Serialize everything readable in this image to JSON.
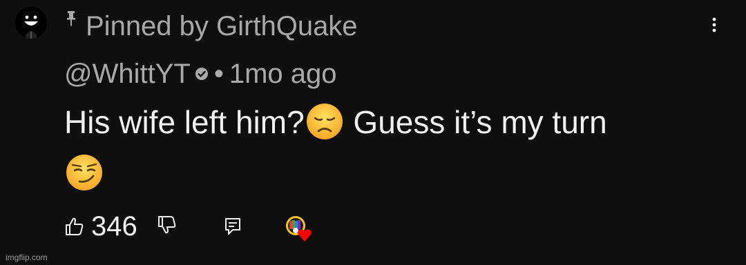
{
  "header": {
    "pinned_label": "Pinned by GirthQuake",
    "more_options_icon": "vertical-ellipsis-icon"
  },
  "comment": {
    "author": "@WhittYT",
    "verified": true,
    "separator": "•",
    "time_ago": "1mo ago",
    "text_part1": "His wife left him?",
    "emoji1": "disappointed-face",
    "text_part2": " Guess it’s my turn",
    "emoji2": "smirking-face"
  },
  "actions": {
    "like_icon": "thumbs-up-icon",
    "like_count": "346",
    "dislike_icon": "thumbs-down-icon",
    "reply_icon": "comment-icon",
    "creator_heart_icon": "creator-heart-icon"
  },
  "colors": {
    "background": "#0f0f0f",
    "primary_text": "#f1f1f1",
    "secondary_text": "#aaaaaa",
    "heart": "#ff0000"
  },
  "watermark": "imgflip.com"
}
